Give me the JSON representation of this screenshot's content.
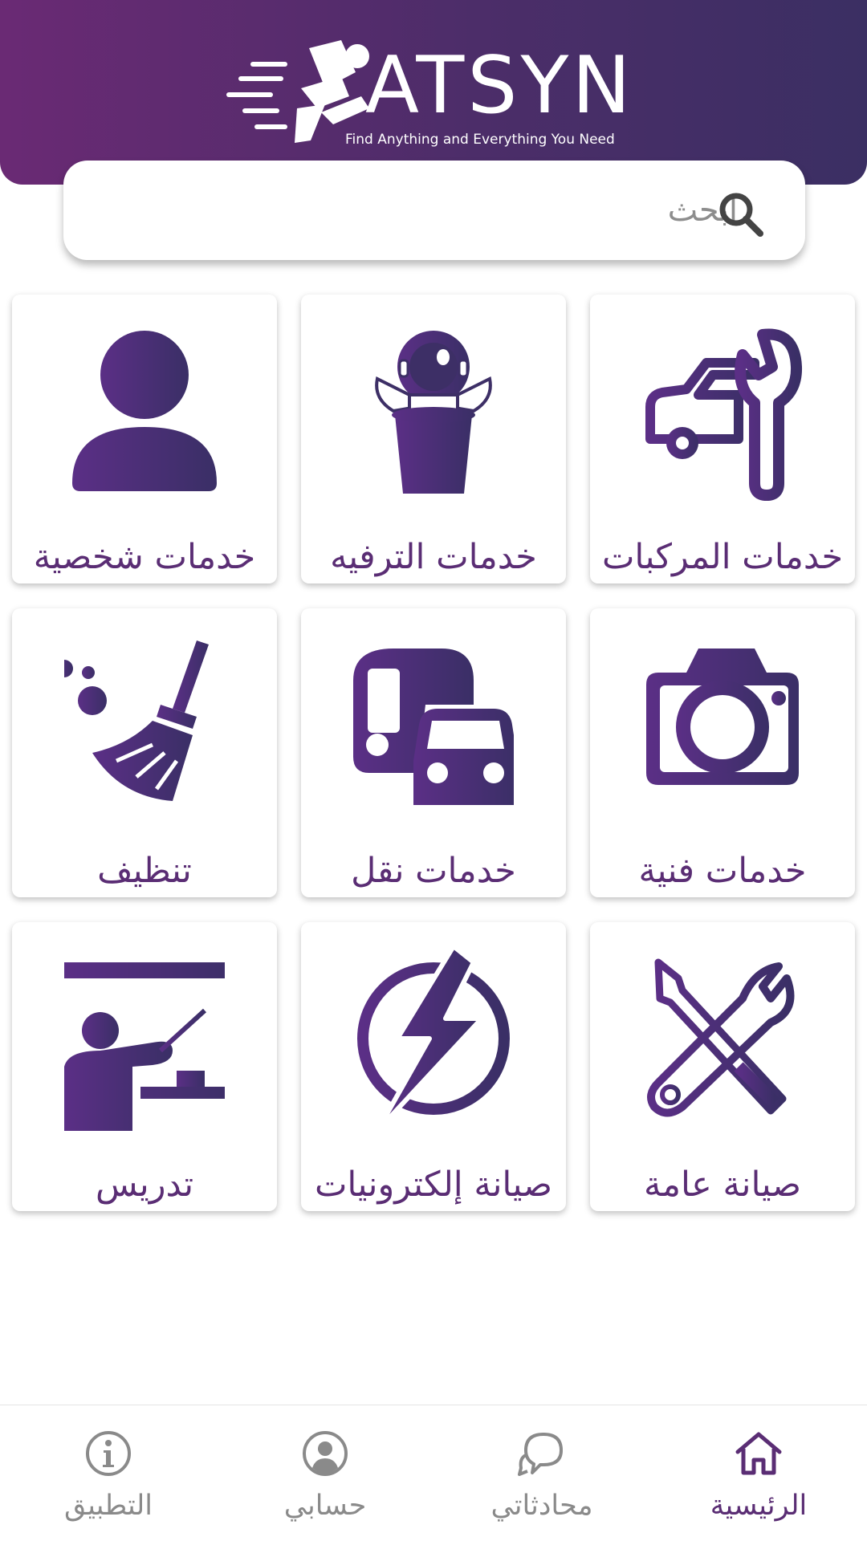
{
  "header": {
    "logo_wordmark": "ATSYN",
    "logo_tagline": "Find Anything and Everything You Need"
  },
  "search": {
    "placeholder": "ابحث",
    "icon": "search-icon"
  },
  "categories": [
    {
      "label": "خدمات المركبات",
      "icon": "car-wrench-icon"
    },
    {
      "label": "خدمات الترفيه",
      "icon": "astronaut-popcorn-icon"
    },
    {
      "label": "خدمات شخصية",
      "icon": "person-icon"
    },
    {
      "label": "خدمات فنية",
      "icon": "camera-icon"
    },
    {
      "label": "خدمات نقل",
      "icon": "bus-car-icon"
    },
    {
      "label": "تنظيف",
      "icon": "broom-icon"
    },
    {
      "label": "صيانة عامة",
      "icon": "wrench-screwdriver-icon"
    },
    {
      "label": "صيانة إلكترونيات",
      "icon": "lightning-icon"
    },
    {
      "label": "تدريس",
      "icon": "teacher-board-icon"
    }
  ],
  "bottom_nav": [
    {
      "label": "الرئيسية",
      "icon": "home-icon",
      "active": true
    },
    {
      "label": "محادثاتي",
      "icon": "chat-icon",
      "active": false
    },
    {
      "label": "حسابي",
      "icon": "account-icon",
      "active": false
    },
    {
      "label": "التطبيق",
      "icon": "info-icon",
      "active": false
    }
  ],
  "colors": {
    "brand_purple": "#5a2d74",
    "header_gradient_start": "#6a2a74",
    "header_gradient_end": "#3b2f63",
    "inactive_gray": "#8a8a8a"
  }
}
